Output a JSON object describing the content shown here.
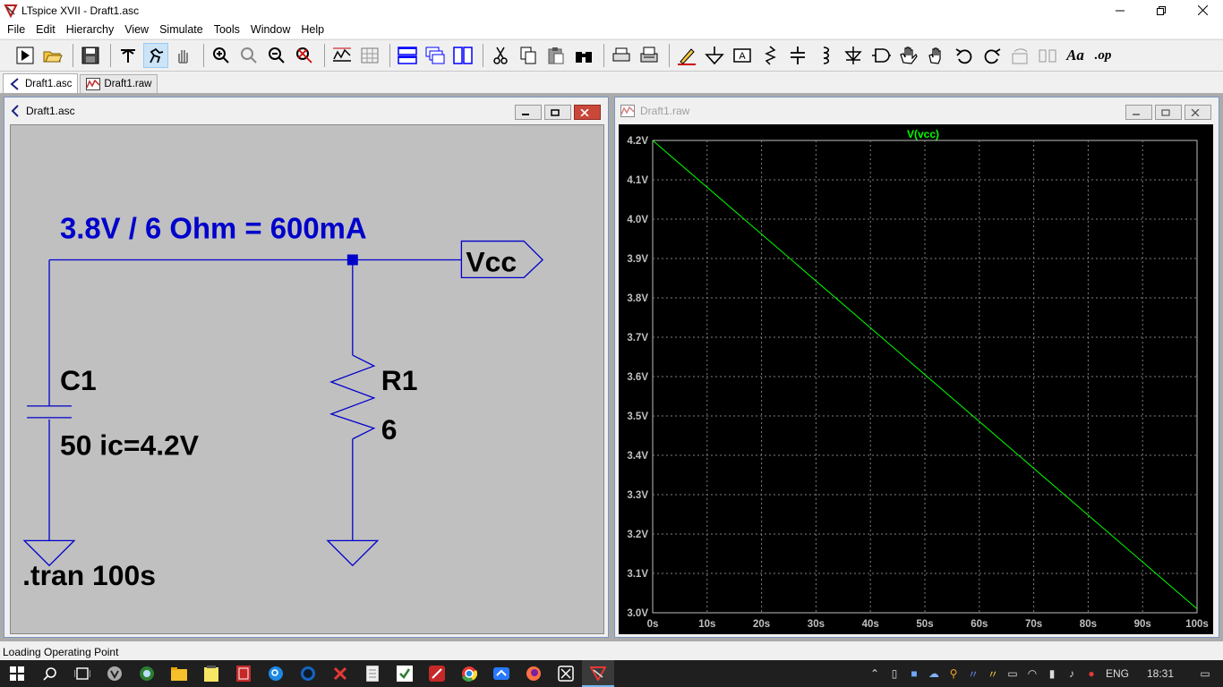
{
  "window": {
    "title": "LTspice XVII - Draft1.asc"
  },
  "menu": [
    "File",
    "Edit",
    "Hierarchy",
    "View",
    "Simulate",
    "Tools",
    "Window",
    "Help"
  ],
  "toolbar": {
    "groups": [
      [
        "run-icon",
        "open-icon"
      ],
      [
        "save-icon"
      ],
      [
        "control-panel-icon",
        "halt-icon",
        "pan-icon"
      ],
      [
        "zoom-in-icon",
        "zoom-area-icon",
        "zoom-out-icon",
        "zoom-fit-icon"
      ],
      [
        "autorange-icon",
        "grid-icon"
      ],
      [
        "tile-horizontal-icon",
        "cascade-icon",
        "tile-vertical-icon"
      ],
      [
        "cut-icon",
        "copy-icon",
        "paste-icon",
        "find-icon"
      ],
      [
        "print-preview-icon",
        "print-icon"
      ],
      [
        "draw-wire-icon",
        "ground-icon",
        "label-net-icon",
        "resistor-icon",
        "capacitor-icon",
        "inductor-icon",
        "diode-icon",
        "component-icon",
        "move-icon",
        "drag-icon",
        "undo-icon",
        "redo-icon",
        "rotate-icon",
        "mirror-icon",
        "text-icon",
        "spice-directive-icon"
      ]
    ],
    "spice_label": ".op",
    "text_label": "Aa"
  },
  "tabs": [
    {
      "label": "Draft1.asc",
      "active": true
    },
    {
      "label": "Draft1.raw",
      "active": false
    }
  ],
  "schematic": {
    "title": "Draft1.asc",
    "heading": "3.8V / 6 Ohm = 600mA",
    "net_label": "Vcc",
    "cap_name": "C1",
    "cap_value": "50 ic=4.2V",
    "res_name": "R1",
    "res_value": "6",
    "directive": ".tran 100s",
    "colors": {
      "background": "#c0c0c0",
      "wire": "#0000cc",
      "text": "#000000",
      "heading": "#0000cc"
    }
  },
  "waveform": {
    "title": "Draft1.raw",
    "colors": {
      "background": "#000000",
      "trace": "#00ff00",
      "grid": "#808080",
      "axis_text": "#c0c0c0",
      "title": "#00ff00"
    }
  },
  "chart_data": {
    "type": "line",
    "title": "V(vcc)",
    "xlabel": "",
    "ylabel": "",
    "xlim": [
      0,
      100
    ],
    "ylim": [
      3.0,
      4.2
    ],
    "x_ticks": [
      "0s",
      "10s",
      "20s",
      "30s",
      "40s",
      "50s",
      "60s",
      "70s",
      "80s",
      "90s",
      "100s"
    ],
    "y_ticks": [
      "4.2V",
      "4.1V",
      "4.0V",
      "3.9V",
      "3.8V",
      "3.7V",
      "3.6V",
      "3.5V",
      "3.4V",
      "3.3V",
      "3.2V",
      "3.1V",
      "3.0V"
    ],
    "grid": true,
    "series": [
      {
        "name": "V(vcc)",
        "x": [
          0,
          100
        ],
        "y": [
          4.2,
          3.01
        ]
      }
    ]
  },
  "status": {
    "text": "Loading Operating Point"
  },
  "taskbar": {
    "apps": [
      "start-icon",
      "search-icon",
      "task-view-icon",
      "app-gray-icon",
      "app-globe-icon",
      "file-explorer-icon",
      "notepad-icon",
      "app-red-icon",
      "app-blue-icon",
      "app-dark-icon",
      "app-x-icon",
      "app-doc-icon",
      "app-check-icon",
      "app-pen-icon",
      "chrome-icon",
      "app-cloud-icon",
      "firefox-icon",
      "app-box-icon",
      "ltspice-icon"
    ],
    "language": "ENG",
    "time": "18:31"
  }
}
